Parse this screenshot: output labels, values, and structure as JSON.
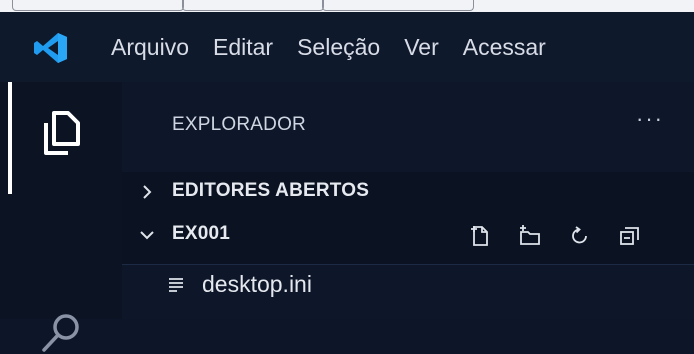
{
  "menu": {
    "items": [
      "Arquivo",
      "Editar",
      "Seleção",
      "Ver",
      "Acessar"
    ]
  },
  "explorer": {
    "title": "EXPLORADOR",
    "more_actions": "···",
    "open_editors_label": "EDITORES ABERTOS",
    "folder_label": "EX001",
    "files": [
      {
        "name": "desktop.ini",
        "icon": "lines-file-icon"
      }
    ]
  },
  "colors": {
    "background": "#0d1628",
    "titlebar": "#0f192c",
    "vscode_blue": "#1f9cf0"
  }
}
